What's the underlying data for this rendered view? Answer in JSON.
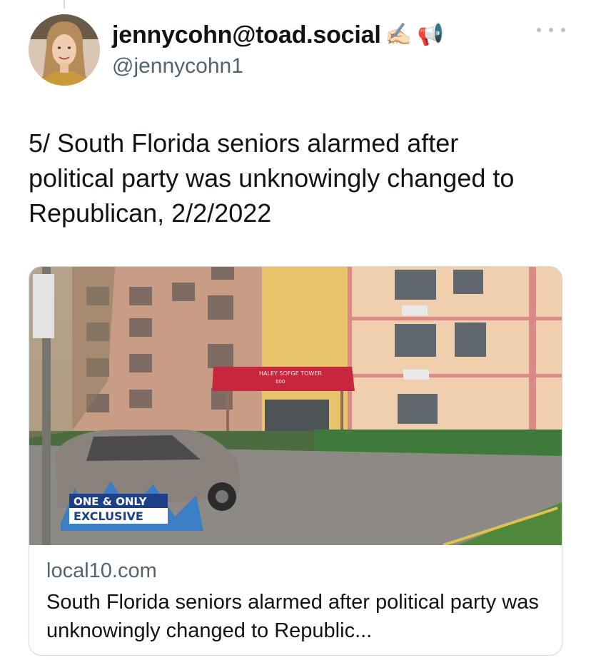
{
  "author": {
    "display_name": "jennycohn@toad.social",
    "emoji": "✍🏻 📢",
    "handle": "@jennycohn1",
    "avatar_icon": "profile-photo"
  },
  "more_icon": "ellipsis-icon",
  "tweet": {
    "text": "5/ South Florida seniors alarmed after\npolitical party was unknowingly changed to\nRepublican, 2/2/2022"
  },
  "link_card": {
    "image_sign": "HALEY SOFGE TOWER",
    "image_sign_number": "800",
    "image_badge_line1": "ONE & ONLY",
    "image_badge_line2": "EXCLUSIVE",
    "domain": "local10.com",
    "title": "South Florida seniors alarmed after political party was unknowingly changed to Republic..."
  },
  "colors": {
    "text_primary": "#0f1419",
    "text_secondary": "#536471",
    "border": "#cfd9de",
    "awning": "#c8263e"
  }
}
